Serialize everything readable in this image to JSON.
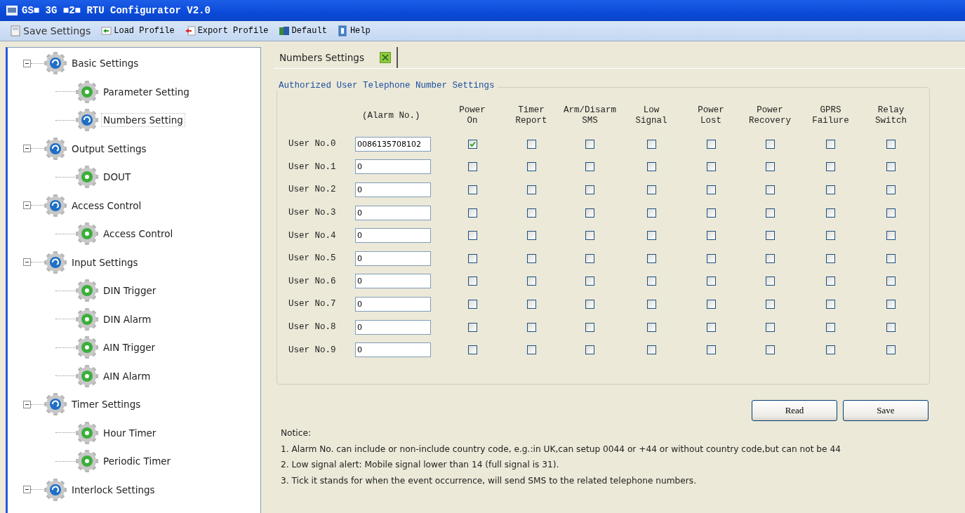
{
  "window": {
    "title": "GS■ 3G ■2■ RTU Configurator V2.0"
  },
  "toolbar": [
    {
      "label": "Save Settings",
      "kind": "save"
    },
    {
      "label": "Load Profile",
      "kind": "load"
    },
    {
      "label": "Export Profile",
      "kind": "export"
    },
    {
      "label": "Default",
      "kind": "default"
    },
    {
      "label": "Help",
      "kind": "help"
    }
  ],
  "sidebar": {
    "items": [
      {
        "label": "Basic Settings",
        "expanded": true,
        "children": [
          {
            "label": "Parameter Setting",
            "selected": false
          },
          {
            "label": "Numbers Setting",
            "selected": true
          }
        ]
      },
      {
        "label": "Output Settings",
        "expanded": true,
        "children": [
          {
            "label": "DOUT",
            "selected": false
          }
        ]
      },
      {
        "label": "Access Control",
        "expanded": true,
        "children": [
          {
            "label": "Access Control",
            "selected": false
          }
        ]
      },
      {
        "label": "Input Settings",
        "expanded": true,
        "children": [
          {
            "label": "DIN Trigger",
            "selected": false
          },
          {
            "label": "DIN Alarm",
            "selected": false
          },
          {
            "label": "AIN Trigger",
            "selected": false
          },
          {
            "label": "AIN Alarm",
            "selected": false
          }
        ]
      },
      {
        "label": "Timer Settings",
        "expanded": true,
        "children": [
          {
            "label": "Hour Timer",
            "selected": false
          },
          {
            "label": "Periodic Timer",
            "selected": false
          }
        ]
      },
      {
        "label": "Interlock Settings",
        "expanded": true
      }
    ]
  },
  "tabs": [
    {
      "label": "Numbers Settings",
      "selected": true
    }
  ],
  "group": {
    "title": "Authorized User Telephone Number Settings",
    "columns": [
      "(Alarm No.)",
      "Power\nOn",
      "Timer\nReport",
      "Arm/Disarm\nSMS",
      "Low\nSignal",
      "Power\nLost",
      "Power\nRecovery",
      "GPRS\nFailure",
      "Relay\nSwitch"
    ],
    "rows": [
      {
        "label": "User No.0",
        "value": "0086135708102",
        "checks": [
          true,
          false,
          false,
          false,
          false,
          false,
          false,
          false
        ]
      },
      {
        "label": "User No.1",
        "value": "0",
        "checks": [
          false,
          false,
          false,
          false,
          false,
          false,
          false,
          false
        ]
      },
      {
        "label": "User No.2",
        "value": "0",
        "checks": [
          false,
          false,
          false,
          false,
          false,
          false,
          false,
          false
        ]
      },
      {
        "label": "User No.3",
        "value": "0",
        "checks": [
          false,
          false,
          false,
          false,
          false,
          false,
          false,
          false
        ]
      },
      {
        "label": "User No.4",
        "value": "0",
        "checks": [
          false,
          false,
          false,
          false,
          false,
          false,
          false,
          false
        ]
      },
      {
        "label": "User No.5",
        "value": "0",
        "checks": [
          false,
          false,
          false,
          false,
          false,
          false,
          false,
          false
        ]
      },
      {
        "label": "User No.6",
        "value": "0",
        "checks": [
          false,
          false,
          false,
          false,
          false,
          false,
          false,
          false
        ]
      },
      {
        "label": "User No.7",
        "value": "0",
        "checks": [
          false,
          false,
          false,
          false,
          false,
          false,
          false,
          false
        ]
      },
      {
        "label": "User No.8",
        "value": "0",
        "checks": [
          false,
          false,
          false,
          false,
          false,
          false,
          false,
          false
        ]
      },
      {
        "label": "User No.9",
        "value": "0",
        "checks": [
          false,
          false,
          false,
          false,
          false,
          false,
          false,
          false
        ]
      }
    ]
  },
  "buttons": [
    "Read",
    "Save"
  ],
  "notice": {
    "title": "Notice:",
    "lines": [
      "1. Alarm No. can include or non-include country code, e.g.:in UK,can setup 0044 or +44 or without country code,but can not be 44",
      "2. Low signal alert: Mobile signal lower than 14 (full signal is 31).",
      "3. Tick it stands for when the event occurrence, will send SMS to the related telephone numbers."
    ]
  }
}
